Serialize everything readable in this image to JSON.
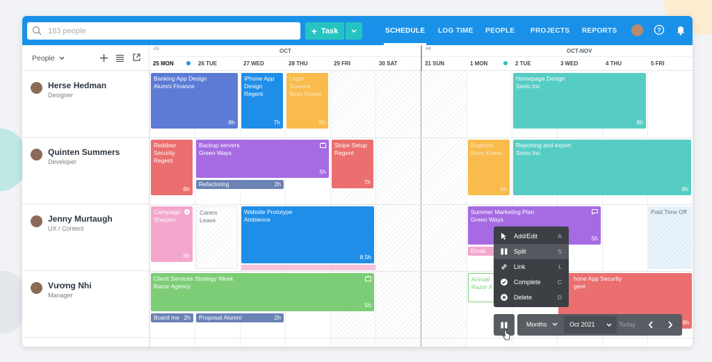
{
  "search": {
    "placeholder": "183 people"
  },
  "task_button": {
    "label": "Task"
  },
  "nav": [
    {
      "label": "SCHEDULE"
    },
    {
      "label": "LOG TIME"
    },
    {
      "label": "PEOPLE"
    },
    {
      "label": "PROJECTS"
    },
    {
      "label": "REPORTS"
    }
  ],
  "sidebar": {
    "people_label": "People"
  },
  "weeks": [
    {
      "number": "43",
      "month": "OCT"
    },
    {
      "number": "44",
      "month": "OCT-NOV"
    }
  ],
  "days": [
    "25 MON",
    "26 TUE",
    "27 WED",
    "28 THU",
    "29 FRI",
    "30 SAT",
    "31 SUN",
    "1 MON",
    "2 TUE",
    "3 WED",
    "4 THU",
    "5 FRI"
  ],
  "people": [
    {
      "name": "Herse Hedman",
      "role": "Designer"
    },
    {
      "name": "Quinten Summers",
      "role": "Developer"
    },
    {
      "name": "Jenny Murtaugh",
      "role": "UX / Content"
    },
    {
      "name": "Vương Nhi",
      "role": "Manager"
    }
  ],
  "cards": {
    "c1": {
      "l1": "Banking App Design",
      "l2": "Alumni Finance",
      "hrs": "8h"
    },
    "c2": {
      "l1": "iPhone App",
      "l2": "Design",
      "l3": "Regent",
      "hrs": "7h"
    },
    "c3": {
      "l1": "Login",
      "l2": "Screens",
      "l3": "Bees Knees",
      "hrs": "8h"
    },
    "c4": {
      "l1": "Homepage Design",
      "l2": "Sonic Inc",
      "hrs": "8h"
    },
    "c5": {
      "l1": "Reddoor",
      "l2": "Security",
      "l3": "Regent",
      "hrs": "8h"
    },
    "c6": {
      "l1": "Backup servers",
      "l2": "Green Ways",
      "hrs": "5h"
    },
    "c7": {
      "l1": "Stripe Setup",
      "l2": "Regent",
      "hrs": "7h"
    },
    "c8": {
      "l1": "Bugfixes",
      "l2": "Bees Knees",
      "hrs": "8h"
    },
    "c9": {
      "l1": "Reporting and export",
      "l2": "Sonic Inc",
      "hrs": "8h"
    },
    "c10": {
      "l1": "Campaign",
      "l2": "Sharpes",
      "hrs": "8h"
    },
    "c11": {
      "l1": "Carers Leave"
    },
    "c12": {
      "l1": "Website Prototype",
      "l2": "Ambience",
      "hrs": "8.5h"
    },
    "c13": {
      "l1": "Summer Marketing Plan",
      "l2": "Green Ways",
      "hrs": "5h"
    },
    "c14": {
      "l1": "Email Ca"
    },
    "c15": {
      "l1": "Paid Time Off"
    },
    "c16": {
      "l1": "Client Services Strategy Week",
      "l2": "Razor Agency",
      "hrs": "5h"
    },
    "c17": {
      "l1": "Annual",
      "l2": "Razor A"
    },
    "c18": {
      "l1": "hone App Security",
      "l2": "gent",
      "hrs": "8h"
    }
  },
  "subs": {
    "s1": {
      "l1": "Refactoring",
      "hrs": "2h"
    },
    "s2": {
      "l1": "Board me",
      "hrs": "2h"
    },
    "s3": {
      "l1": "Proposal Alumni",
      "hrs": "2h"
    }
  },
  "context_menu": [
    {
      "label": "Add/Edit",
      "key": "A"
    },
    {
      "label": "Split",
      "key": "S"
    },
    {
      "label": "Link",
      "key": "L"
    },
    {
      "label": "Complete",
      "key": "C"
    },
    {
      "label": "Delete",
      "key": "D"
    }
  ],
  "bottombar": {
    "view": "Months",
    "month": "Oct 2021",
    "today": "Today"
  },
  "colors": {
    "topbar": "#1a91e8",
    "accent": "#25c4c0"
  }
}
